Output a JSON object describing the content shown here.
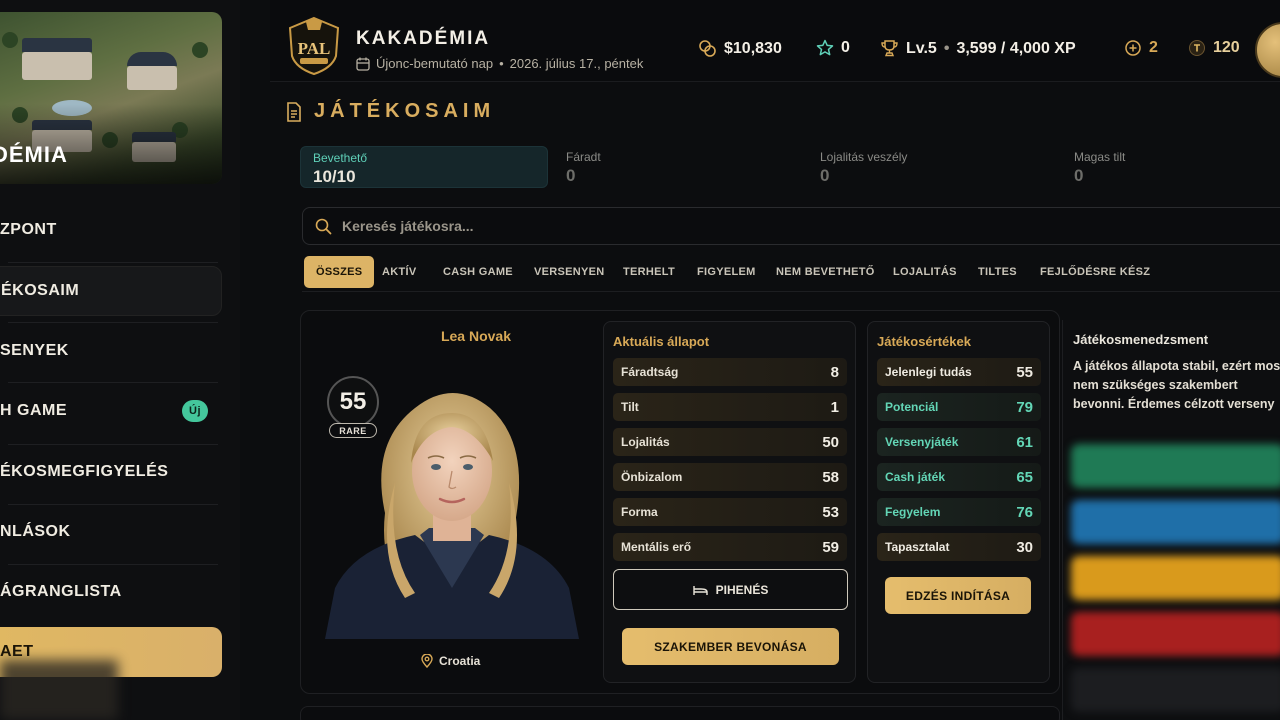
{
  "sidebar": {
    "hero_title": "DÉMIA",
    "items": [
      {
        "label": "ZPONT"
      },
      {
        "label": "ÉKOSAIM"
      },
      {
        "label": "SENYEK"
      },
      {
        "label": "H GAME",
        "badge": "Új"
      },
      {
        "label": "ÉKOSMEGFIGYELÉS"
      },
      {
        "label": "NLÁSOK"
      },
      {
        "label": "ÁGRANGLISTA"
      },
      {
        "label": "AET"
      }
    ]
  },
  "header": {
    "brand": "KAKADÉMIA",
    "logo_text": "PAL",
    "subtitle_day": "Újonc-bemutató nap",
    "subtitle_date": "2026. július 17., péntek",
    "money": "$10,830",
    "stars": "0",
    "level": "Lv.5",
    "xp": "3,599 / 4,000 XP",
    "plus": "2",
    "tokens": "120"
  },
  "section": {
    "title": "JÁTÉKOSAIM"
  },
  "kpis": [
    {
      "label": "Bevethető",
      "value": "10/10"
    },
    {
      "label": "Fáradt",
      "value": "0"
    },
    {
      "label": "Lojalitás veszély",
      "value": "0"
    },
    {
      "label": "Magas tilt",
      "value": "0"
    }
  ],
  "search": {
    "placeholder": "Keresés játékosra..."
  },
  "filters": [
    "ÖSSZES",
    "AKTÍV",
    "CASH GAME",
    "VERSENYEN",
    "TERHELT",
    "FIGYELEM",
    "NEM BEVETHETŐ",
    "LOJALITÁS",
    "TILTES",
    "FEJLŐDÉSRE KÉSZ"
  ],
  "player": {
    "name": "Lea Novak",
    "rating": "55",
    "rarity": "RARE",
    "country": "Croatia"
  },
  "state": {
    "title": "Aktuális állapot",
    "rows": [
      {
        "label": "Fáradtság",
        "value": "8"
      },
      {
        "label": "Tilt",
        "value": "1"
      },
      {
        "label": "Lojalitás",
        "value": "50"
      },
      {
        "label": "Önbizalom",
        "value": "58"
      },
      {
        "label": "Forma",
        "value": "53"
      },
      {
        "label": "Mentális erő",
        "value": "59"
      }
    ],
    "rest_button": "PIHENÉS",
    "specialist_button": "SZAKEMBER BEVONÁSA"
  },
  "attributes": {
    "title": "Játékosértékek",
    "rows": [
      {
        "label": "Jelenlegi tudás",
        "value": "55"
      },
      {
        "label": "Potenciál",
        "value": "79"
      },
      {
        "label": "Versenyjáték",
        "value": "61"
      },
      {
        "label": "Cash játék",
        "value": "65"
      },
      {
        "label": "Fegyelem",
        "value": "76"
      },
      {
        "label": "Tapasztalat",
        "value": "30"
      }
    ],
    "train_button": "EDZÉS INDÍTÁSA"
  },
  "management": {
    "title": "Játékosmenedzsment",
    "text": "A játékos állapota stabil, ezért most nem szükséges szakembert bevonni. Érdemes célzott verseny"
  },
  "colors": {
    "accent_gold": "#ddb466",
    "teal": "#63d6b6",
    "background": "#0c0d0f"
  }
}
